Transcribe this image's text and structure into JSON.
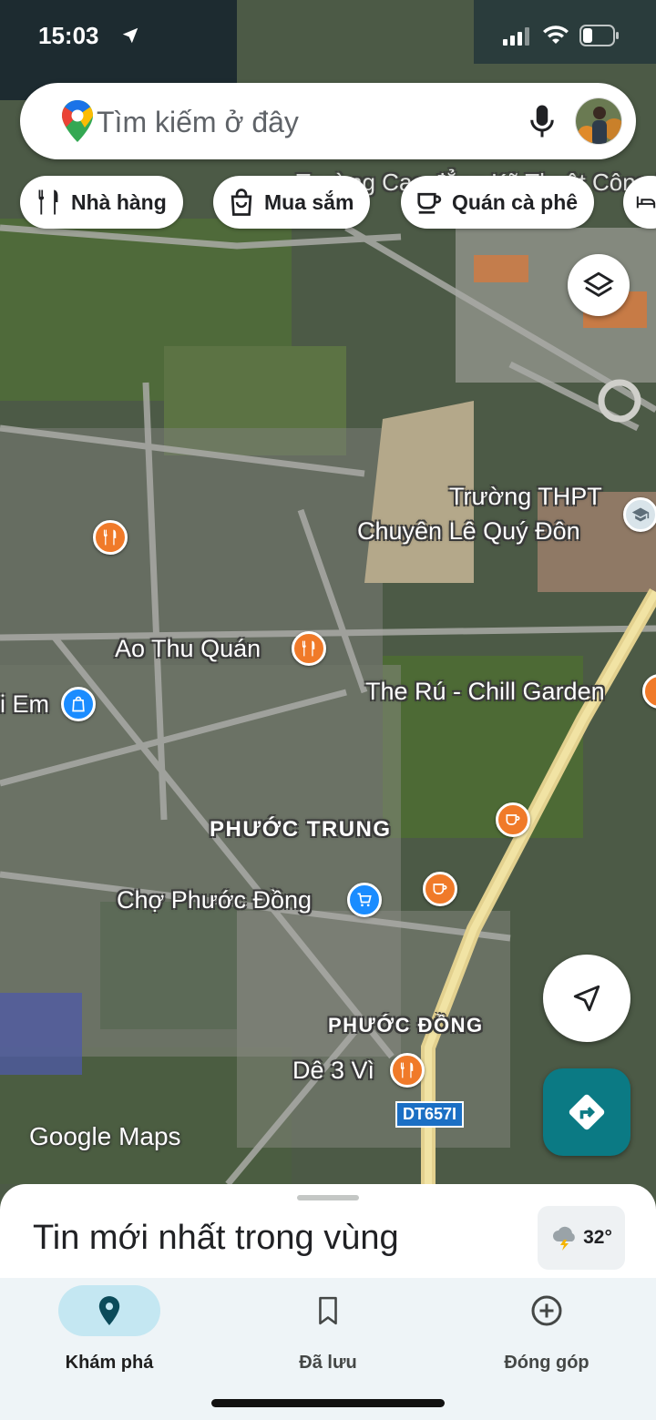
{
  "status_bar": {
    "time": "15:03"
  },
  "search": {
    "placeholder": "Tìm kiếm ở đây"
  },
  "chips": [
    {
      "label": "Nhà hàng",
      "icon": "fork-knife-icon"
    },
    {
      "label": "Mua sắm",
      "icon": "shopping-bag-icon"
    },
    {
      "label": "Quán cà phê",
      "icon": "coffee-cup-icon"
    }
  ],
  "map": {
    "labels": {
      "school_top": "Trường Cao đẳng Kỹ Thuật Công Nghiệp",
      "school_thpt_1": "Trường THPT",
      "school_thpt_2": "Chuyên Lê Quý Đôn",
      "ao_thu": "Ao Thu Quán",
      "em": "i Em",
      "the_ru": "The Rú - Chill Garden",
      "phuoc_trung": "PHƯỚC TRUNG",
      "cho": "Chợ Phước Đồng",
      "phuoc_dong": "PHƯỚC ĐỒNG",
      "de3vi": "Dê 3 Vì",
      "road": "DT657I"
    },
    "watermark": "Google Maps"
  },
  "sheet": {
    "title": "Tin mới nhất trong vùng",
    "weather": {
      "temp": "32°",
      "icon": "thunderstorm-icon"
    }
  },
  "nav": [
    {
      "label": "Khám phá",
      "icon": "location-pin-icon",
      "active": true
    },
    {
      "label": "Đã lưu",
      "icon": "bookmark-icon",
      "active": false
    },
    {
      "label": "Đóng góp",
      "icon": "add-circle-icon",
      "active": false
    }
  ],
  "colors": {
    "accent_teal": "#0b7a84",
    "poi_orange": "#f07a29",
    "poi_blue": "#1a8cff",
    "active_pill": "#c4e7f2"
  }
}
